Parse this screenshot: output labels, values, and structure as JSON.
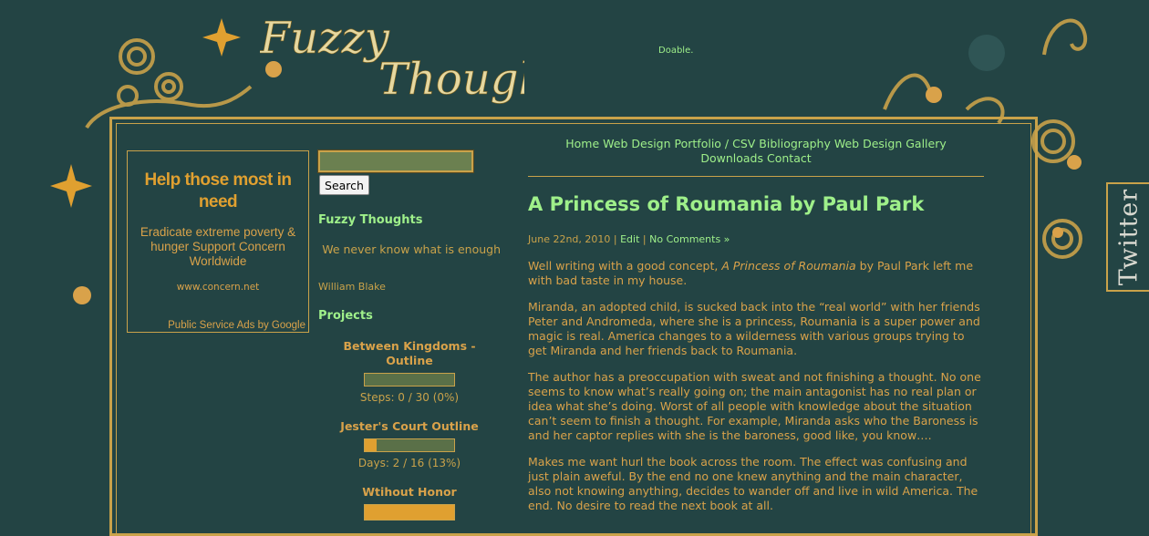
{
  "header": {
    "logo_text": "Fuzzy Thoughts",
    "tagline": "Doable."
  },
  "twitter_tab": {
    "label": "Twitter"
  },
  "ad": {
    "title": "Help those most in need",
    "description": "Eradicate extreme poverty & hunger Support Concern Worldwide",
    "url": "www.concern.net",
    "footer": "Public Service Ads by Google"
  },
  "sidebar": {
    "search_button": "Search",
    "blog_title": "Fuzzy Thoughts",
    "quote": "We never know what is enough",
    "quote_author": "William Blake",
    "projects_heading": "Projects",
    "projects": [
      {
        "title": "Between Kingdoms - Outline",
        "progress_text": "Steps: 0 / 30 (0%)",
        "fraction": 0.0
      },
      {
        "title": "Jester's Court Outline",
        "progress_text": "Days: 2 / 16 (13%)",
        "fraction": 0.13
      },
      {
        "title": "Wtihout Honor",
        "progress_text": "",
        "fraction": 1.0
      }
    ]
  },
  "nav": {
    "items": [
      "Home",
      "Web Design Portfolio / CSV",
      "Bibliography",
      "Web Design Gallery",
      "Downloads",
      "Contact"
    ]
  },
  "post": {
    "title": "A Princess of Roumania by Paul Park",
    "date": "June 22nd, 2010",
    "edit_label": "Edit",
    "comments_label": "No Comments »",
    "p1_before": "Well writing with a good concept, ",
    "p1_italic": "A Princess of Roumania",
    "p1_after": " by Paul Park left me with bad taste in my house.",
    "p2": "Miranda, an adopted child, is sucked back into the “real world” with her friends Peter and Andromeda, where she is a princess, Roumania is a super power and magic is real. America changes to a wilderness with various groups trying to get Miranda and her friends back to Roumania.",
    "p3": "The author has a preoccupation with sweat and not finishing a thought. No one seems to know what’s really going on; the main antagonist has no real plan or idea what she’s doing. Worst of all people with knowledge about the situation can’t seem to finish a thought. For example, Miranda asks who the Baroness is and her captor replies with she is the baroness, good like, you know….",
    "p4": "Makes me want hurl the book across the room. The effect was confusing and just plain aweful. By the end no one knew anything and the main character, also not knowing anything, decides to wander off and live in wild America. The end. No desire to read the next book at all."
  },
  "colors": {
    "background": "#234444",
    "gold": "#c9a24a",
    "accent_green": "#9ff08a",
    "orange": "#e0a030"
  }
}
